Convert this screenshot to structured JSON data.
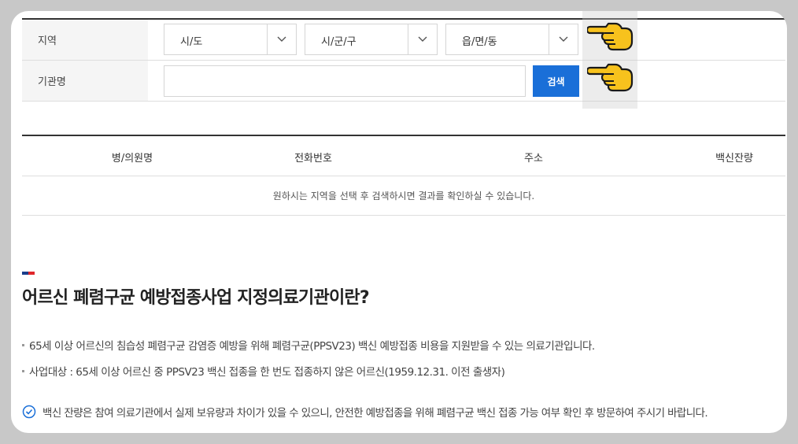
{
  "form": {
    "region_label": "지역",
    "org_label": "기관명",
    "sido": "시/도",
    "sigungu": "시/군/구",
    "eupmyeon": "읍/면/동",
    "org_placeholder": "",
    "search_label": "검색"
  },
  "table": {
    "headers": [
      "병/의원명",
      "전화번호",
      "주소",
      "백신잔량"
    ],
    "empty_message": "원하시는 지역을 선택 후 검색하시면 결과를 확인하실 수 있습니다."
  },
  "info": {
    "title": "어르신 폐렴구균 예방접종사업 지정의료기관이란?",
    "bullets": [
      "65세 이상 어르신의 침습성 폐렴구균 감염증 예방을 위해 폐렴구균(PPSV23) 백신 예방접종 비용을 지원받을 수 있는 의료기관입니다.",
      "사업대상 : 65세 이상 어르신 중 PPSV23 백신 접종을 한 번도 접종하지 않은 어르신(1959.12.31. 이전 출생자)"
    ],
    "notice": "백신 잔량은 참여 의료기관에서 실제 보유량과 차이가 있을 수 있으니, 안전한 예방접종을 위해 폐렴구균 백신 접종 가능 여부 확인 후 방문하여 주시기 바랍니다."
  },
  "colors": {
    "accent": "#1a6fd8",
    "hand": "#f7c21d"
  },
  "icons": [
    "chevron-down-icon",
    "pointing-hand-icon",
    "check-circle-icon"
  ]
}
